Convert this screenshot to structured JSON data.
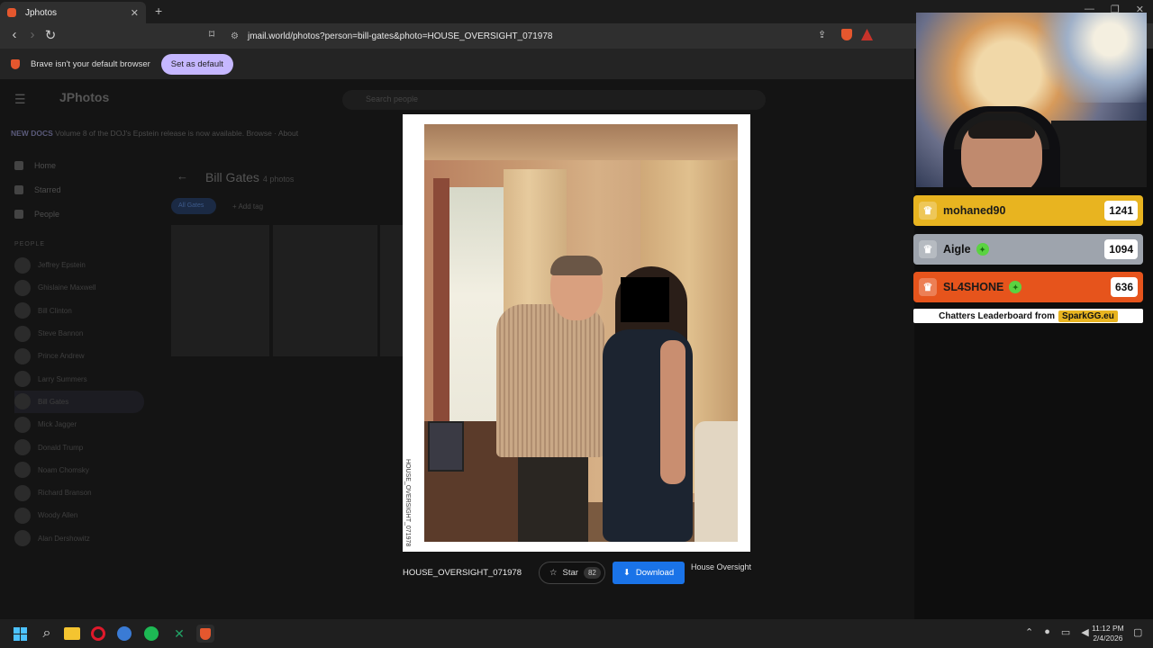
{
  "browser": {
    "tab_title": "Jphotos",
    "tab_close": "✕",
    "new_tab": "+",
    "url": "jmail.world/photos?person=bill-gates&photo=HOUSE_OVERSIGHT_071978",
    "notice_text": "Brave isn't your default browser",
    "set_default_label": "Set as default",
    "window_controls": [
      "—",
      "❐",
      "✕"
    ]
  },
  "page": {
    "logo": "JPhotos",
    "search_placeholder": "Search people",
    "banner_tag": "NEW DOCS",
    "banner_text": "Volume 8 of the DOJ's Epstein release is now available. Browse · About",
    "nav": [
      "Home",
      "Starred",
      "People"
    ],
    "people_header": "PEOPLE",
    "people": [
      "Jeffrey Epstein",
      "Ghislaine Maxwell",
      "Bill Clinton",
      "Steve Bannon",
      "Prince Andrew",
      "Larry Summers",
      "Bill Gates",
      "Mick Jagger",
      "Donald Trump",
      "Noam Chomsky",
      "Richard Branson",
      "Woody Allen",
      "Alan Dershowitz"
    ],
    "person_title": "Bill Gates",
    "person_count": "4 photos",
    "chip_active": "All Gates",
    "chip_other": "+ Add tag"
  },
  "modal": {
    "vertical_caption": "HOUSE_OVERSIGHT_071978",
    "filename": "HOUSE_OVERSIGHT_071978",
    "star_label": "Star",
    "star_count": "82",
    "download_label": "Download",
    "source_label": "House Oversight"
  },
  "leaderboard": {
    "rows": [
      {
        "name": "mohaned90",
        "score": "1241",
        "color": "#e8b420"
      },
      {
        "name": "Aigle",
        "score": "1094",
        "color": "#9ea4ad"
      },
      {
        "name": "SL4SHONE",
        "score": "636",
        "color": "#e6541c"
      }
    ],
    "footer_text": "Chatters Leaderboard from",
    "footer_brand": "SparkGG.eu"
  },
  "taskbar": {
    "time": "11:12 PM",
    "date": "2/4/2026"
  },
  "icons": {
    "back": "‹",
    "forward": "›",
    "reload": "↻",
    "bookmark": "⌑",
    "star": "☆",
    "download": "⬇",
    "crown": "♛",
    "gem": "✦",
    "hamburger": "☰",
    "search": "⌕",
    "tray_chevron": "⌃",
    "mic": "🎙",
    "speaker": "🔊",
    "notification": "🗨"
  }
}
